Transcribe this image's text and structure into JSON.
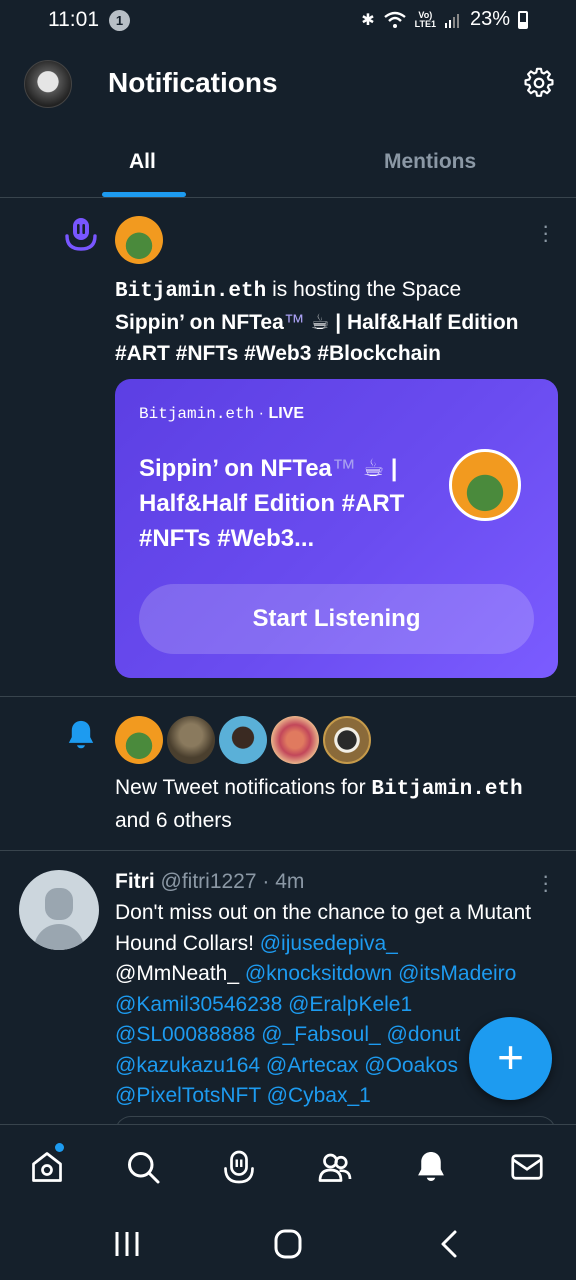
{
  "status_bar": {
    "time": "11:01",
    "notification_count": "1",
    "network": "VoLTE LTE1",
    "battery": "23%"
  },
  "header": {
    "title": "Notifications"
  },
  "tabs": [
    {
      "label": "All",
      "active": true
    },
    {
      "label": "Mentions",
      "active": false
    }
  ],
  "space_notification": {
    "host": "Bitjamin.eth",
    "action_text": " is hosting the Space",
    "space_title_line": "Sippin’ on NFTea",
    "tm": "™",
    "space_title_rest": "☕ | Half&Half Edition #ART #NFTs #Web3 #Blockchain",
    "card": {
      "host": "Bitjamin.eth",
      "separator": " · ",
      "live": "LIVE",
      "title_main": "Sippin’ on NFTea",
      "title_tm": "™",
      "title_rest": "☕ | Half&Half Edition #ART #NFTs #Web3...",
      "button": "Start Listening"
    }
  },
  "tweet_notification": {
    "prefix": "New Tweet notifications for ",
    "user": "Bitjamin.eth",
    "suffix": "and 6 others"
  },
  "tweet": {
    "name": "Fitri",
    "handle": "@fitri1227",
    "time": " · 4m",
    "text_part1": "Don't miss out on the chance to get a Mutant Hound Collars! ",
    "mention1": "@ijusedepiva_",
    "text_part2": "@MmNeath_ ",
    "mentions_rest": [
      "@knocksitdown",
      "@itsMadeiro",
      "@Kamil30546238",
      "@EralpKele1",
      "@SL00088888",
      "@_Fabsoul_",
      "@donut",
      "@kazukazu164",
      "@Artecax",
      "@Ooakos",
      "@PixelTotsNFT",
      "@Cybax_1"
    ]
  },
  "fab": {
    "label": "+"
  },
  "colors": {
    "background": "#15202b",
    "accent": "#1d9bf0",
    "space_purple": "#6a4cf0",
    "divider": "#38444d",
    "secondary_text": "#8b98a5"
  },
  "bottom_nav": [
    "home-icon",
    "search-icon",
    "spaces-icon",
    "communities-icon",
    "notifications-icon",
    "messages-icon"
  ]
}
